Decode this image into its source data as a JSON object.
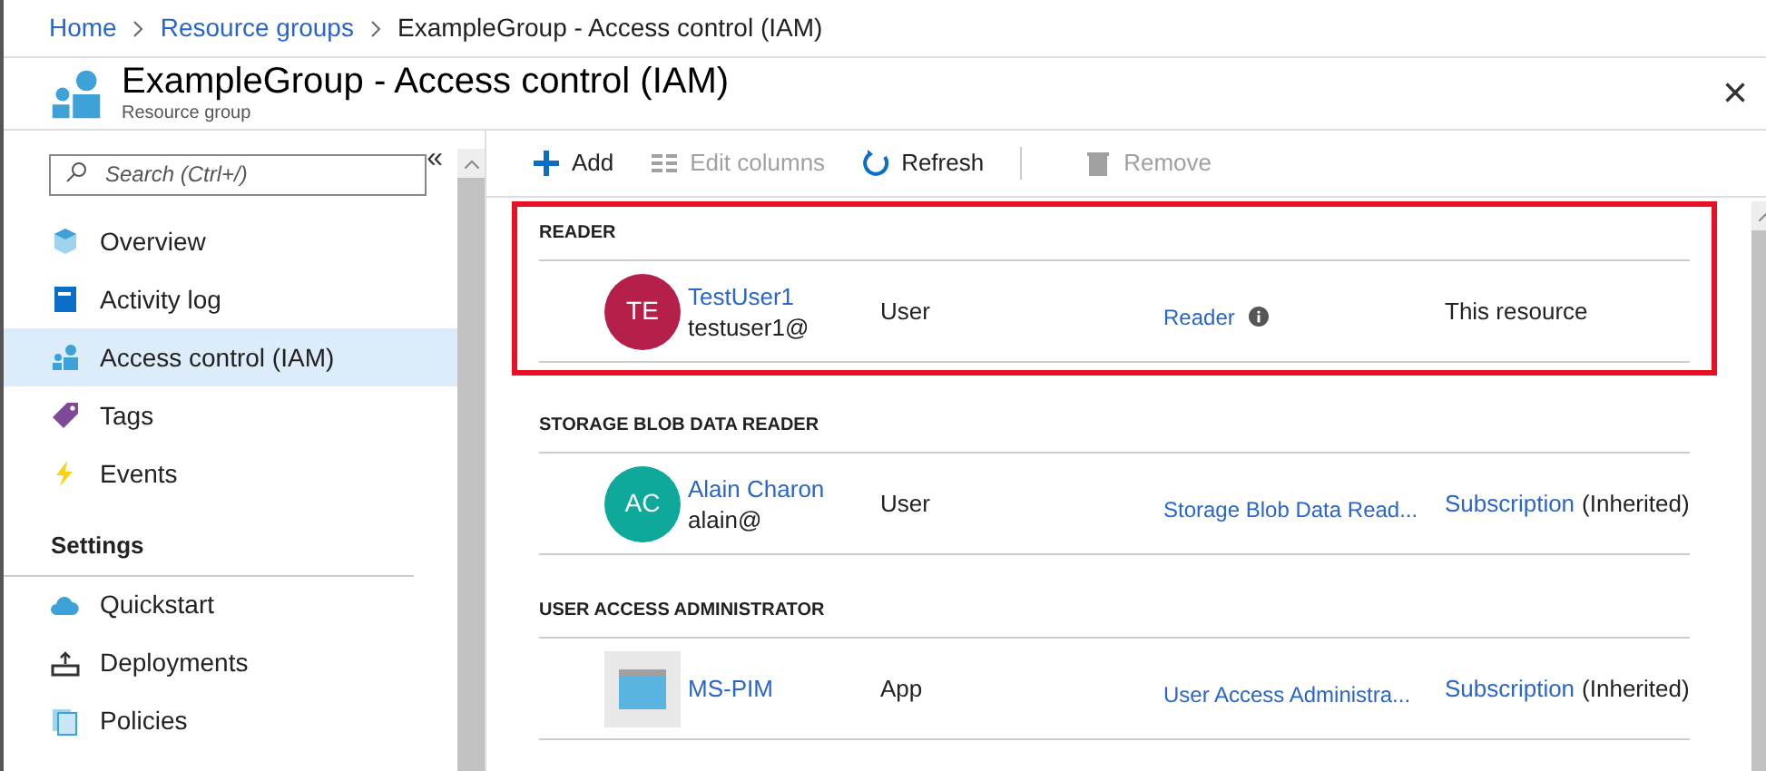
{
  "breadcrumb": [
    {
      "label": "Home"
    },
    {
      "label": "Resource groups"
    },
    {
      "label": "ExampleGroup - Access control (IAM)"
    }
  ],
  "header": {
    "title": "ExampleGroup - Access control (IAM)",
    "subtitle": "Resource group",
    "close": "×"
  },
  "sidebar": {
    "collapse": "«",
    "search": {
      "placeholder": "Search (Ctrl+/)"
    },
    "items": [
      {
        "label": "Overview",
        "selected": false
      },
      {
        "label": "Activity log",
        "selected": false
      },
      {
        "label": "Access control (IAM)",
        "selected": true
      },
      {
        "label": "Tags",
        "selected": false
      },
      {
        "label": "Events",
        "selected": false
      }
    ],
    "sections": [
      {
        "title": "Settings",
        "items": [
          {
            "label": "Quickstart",
            "selected": false
          },
          {
            "label": "Deployments",
            "selected": false
          },
          {
            "label": "Policies",
            "selected": false
          }
        ]
      }
    ]
  },
  "toolbar": [
    {
      "label": "Add",
      "disabled": false
    },
    {
      "label": "Edit columns",
      "disabled": true
    },
    {
      "label": "Refresh",
      "disabled": false
    },
    {
      "label": "Remove",
      "disabled": true
    }
  ],
  "groups": [
    {
      "title": "READER",
      "highlighted": true,
      "rows": [
        {
          "avatar": {
            "kind": "initials",
            "text": "TE",
            "color": "#b4204a"
          },
          "name": "TestUser1",
          "email": "testuser1@",
          "type": "User",
          "role": "Reader",
          "role_info": true,
          "scope": "This resource",
          "scope_link": false
        }
      ]
    },
    {
      "title": "STORAGE BLOB DATA READER",
      "highlighted": false,
      "rows": [
        {
          "avatar": {
            "kind": "initials",
            "text": "AC",
            "color": "#0ea99a"
          },
          "name": "Alain Charon",
          "email": "alain@",
          "type": "User",
          "role": "Storage Blob Data Read...",
          "role_info": false,
          "scope": "Subscription",
          "scope_link": true,
          "scope_note": "(Inherited)"
        }
      ]
    },
    {
      "title": "USER ACCESS ADMINISTRATOR",
      "highlighted": false,
      "rows": [
        {
          "avatar": {
            "kind": "app"
          },
          "name": "MS-PIM",
          "type": "App",
          "role": "User Access Administra...",
          "role_info": false,
          "scope": "Subscription",
          "scope_link": true,
          "scope_note": "(Inherited)"
        }
      ]
    }
  ]
}
